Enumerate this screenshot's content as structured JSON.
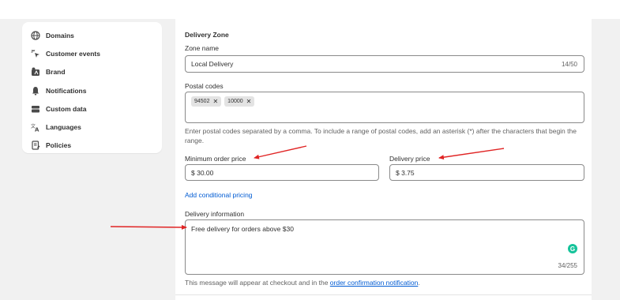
{
  "sidebar": {
    "items": [
      {
        "label": "Domains",
        "icon": "globe-icon"
      },
      {
        "label": "Customer events",
        "icon": "cursor-sparkle-icon"
      },
      {
        "label": "Brand",
        "icon": "brand-tag-icon"
      },
      {
        "label": "Notifications",
        "icon": "bell-icon"
      },
      {
        "label": "Custom data",
        "icon": "folder-data-icon"
      },
      {
        "label": "Languages",
        "icon": "translate-icon"
      },
      {
        "label": "Policies",
        "icon": "document-icon"
      }
    ]
  },
  "delivery_zone": {
    "heading": "Delivery Zone",
    "zone_name_label": "Zone name",
    "zone_name_value": "Local Delivery",
    "zone_name_count": "14/50",
    "postal_codes_label": "Postal codes",
    "postal_codes": [
      "94502",
      "10000"
    ],
    "postal_help": "Enter postal codes separated by a comma. To include a range of postal codes, add an asterisk (*) after the characters that begin the range.",
    "min_order_label": "Minimum order price",
    "min_order_value": "$ 30.00",
    "delivery_price_label": "Delivery price",
    "delivery_price_value": "$ 3.75",
    "conditional_pricing_link": "Add conditional pricing",
    "delivery_info_label": "Delivery information",
    "delivery_info_value": "Free delivery for orders above $30",
    "delivery_info_count": "34/255",
    "footer_text_before": "This message will appear at checkout and in the ",
    "footer_link": "order confirmation notification",
    "footer_text_after": "."
  },
  "colors": {
    "annotation_arrow": "#e02424",
    "link": "#005bd3",
    "grammarly": "#15c39a"
  }
}
